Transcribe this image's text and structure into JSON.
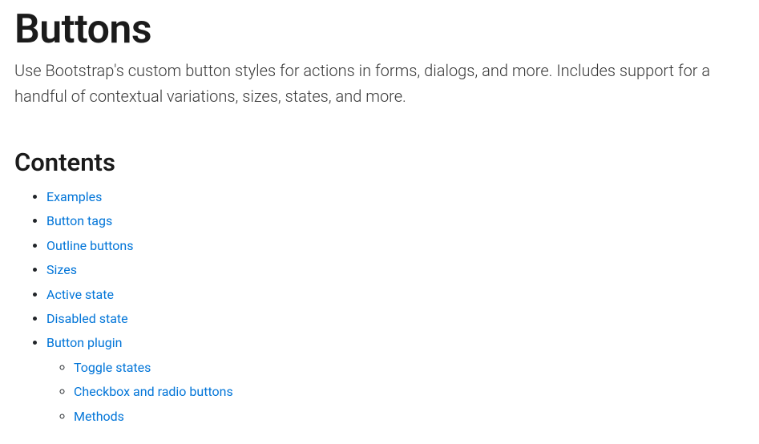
{
  "title": "Buttons",
  "lead": "Use Bootstrap's custom button styles for actions in forms, dialogs, and more. Includes support for a handful of contextual variations, sizes, states, and more.",
  "contents_heading": "Contents",
  "toc": [
    {
      "label": "Examples"
    },
    {
      "label": "Button tags"
    },
    {
      "label": "Outline buttons"
    },
    {
      "label": "Sizes"
    },
    {
      "label": "Active state"
    },
    {
      "label": "Disabled state"
    },
    {
      "label": "Button plugin",
      "children": [
        {
          "label": "Toggle states"
        },
        {
          "label": "Checkbox and radio buttons"
        },
        {
          "label": "Methods"
        }
      ]
    }
  ]
}
